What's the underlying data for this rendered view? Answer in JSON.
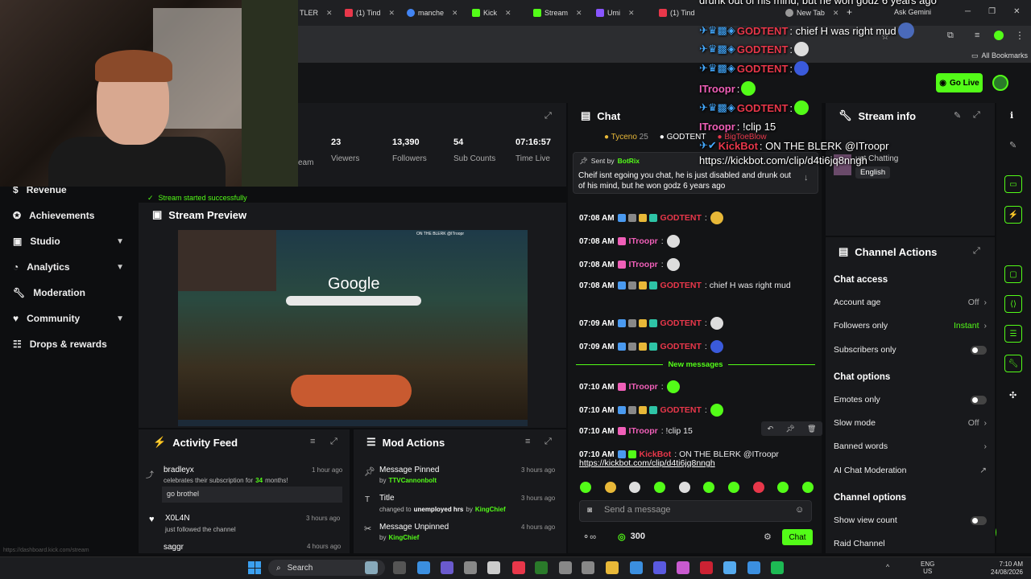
{
  "tabs": [
    {
      "label": "TLER"
    },
    {
      "label": "(1) Tind"
    },
    {
      "label": "manche"
    },
    {
      "label": "Kick"
    },
    {
      "label": "Stream"
    },
    {
      "label": "Umi"
    },
    {
      "label": "(1) Tind"
    },
    {
      "label": "New Tab"
    }
  ],
  "browser": {
    "ask_gemini": "Ask Gemini",
    "all_bookmarks": "All Bookmarks",
    "plus": "+"
  },
  "header": {
    "go_live": "Go Live"
  },
  "sidebar": [
    {
      "label": "Revenue"
    },
    {
      "label": "Achievements"
    },
    {
      "label": "Studio"
    },
    {
      "label": "Analytics"
    },
    {
      "label": "Moderation"
    },
    {
      "label": "Community"
    },
    {
      "label": "Drops & rewards"
    }
  ],
  "stats": [
    {
      "value": "23",
      "label": "Viewers"
    },
    {
      "value": "13,390",
      "label": "Followers"
    },
    {
      "value": "54",
      "label": "Sub Counts"
    },
    {
      "value": "07:16:57",
      "label": "Time Live"
    }
  ],
  "stats_partial": "eam",
  "toast": "Stream started successfully",
  "preview": {
    "title": "Stream Preview",
    "google": "Google",
    "card_text": "ON THE BLERK @ITroopr"
  },
  "activity": {
    "title": "Activity Feed",
    "items": [
      {
        "name": "bradleyx",
        "sub": "celebrates their subscription for",
        "months": "34",
        "months_suffix": "months!",
        "time": "1 hour ago",
        "msg": "go brothel"
      },
      {
        "name": "X0L4N",
        "sub": "just followed the channel",
        "time": "3 hours ago"
      },
      {
        "name": "saggr",
        "time": "4 hours ago"
      }
    ]
  },
  "mod": {
    "title": "Mod Actions",
    "items": [
      {
        "title": "Message Pinned",
        "by": "by",
        "user": "TTVCannonbolt",
        "time": "3 hours ago"
      },
      {
        "title": "Title",
        "detail_pre": "changed to",
        "detail_bold": "unemployed hrs",
        "detail_by": "by",
        "user": "KingChief",
        "time": "3 hours ago"
      },
      {
        "title": "Message Unpinned",
        "by": "by",
        "user": "KingChief",
        "time": "4 hours ago"
      }
    ]
  },
  "chat": {
    "title": "Chat",
    "top_users": [
      {
        "name": "Tyceno",
        "count": "25"
      },
      {
        "name": "GODTENT"
      },
      {
        "name": "BigToeBlow"
      }
    ],
    "pinned": {
      "sent_by": "Sent by",
      "user": "BotRix",
      "text": "Cheif isnt egoing you chat, he is just disabled and drunk out of his mind, but he won godz 6 years ago"
    },
    "messages": [
      {
        "time": "07:08 AM",
        "user": "GODTENT",
        "color": "red",
        "text": ":"
      },
      {
        "time": "07:08 AM",
        "user": "ITroopr",
        "color": "pink",
        "text": ":"
      },
      {
        "time": "07:08 AM",
        "user": "ITroopr",
        "color": "pink",
        "text": ":"
      },
      {
        "time": "07:08 AM",
        "user": "GODTENT",
        "color": "red",
        "text": ": chief H was right mud"
      },
      {
        "time": "07:09 AM",
        "user": "GODTENT",
        "color": "red",
        "text": ":"
      },
      {
        "time": "07:09 AM",
        "user": "GODTENT",
        "color": "red",
        "text": ":"
      },
      {
        "time": "07:10 AM",
        "user": "ITroopr",
        "color": "pink",
        "text": ":"
      },
      {
        "time": "07:10 AM",
        "user": "GODTENT",
        "color": "red",
        "text": ":"
      },
      {
        "time": "07:10 AM",
        "user": "ITroopr",
        "color": "pink",
        "text": ": !clip 15"
      },
      {
        "time": "07:10 AM",
        "user": "KickBot",
        "color": "red",
        "text": ": ON THE BLERK @ITroopr"
      }
    ],
    "new_messages": "New messages",
    "link": "https://kickbot.com/clip/d4ti6jq8nngh",
    "placeholder": "Send a message",
    "points": "300",
    "chat_btn": "Chat"
  },
  "stream_info": {
    "title": "Stream info",
    "partial": "ust Chatting",
    "language": "English"
  },
  "channel_actions": {
    "title": "Channel Actions",
    "chat_access": "Chat access",
    "account_age": "Account age",
    "account_age_v": "Off",
    "followers_only": "Followers only",
    "followers_only_v": "Instant",
    "subs_only": "Subscribers only",
    "chat_options": "Chat options",
    "emotes_only": "Emotes only",
    "slow_mode": "Slow mode",
    "slow_mode_v": "Off",
    "banned_words": "Banned words",
    "ai_mod": "AI Chat Moderation",
    "channel_options": "Channel options",
    "show_view": "Show view count",
    "raid": "Raid Channel"
  },
  "overlay": {
    "line0": "drunk out of his mind, but he won godz 6 years ago",
    "l1_user": "GODTENT",
    "l1_text": ": chief H was right mud",
    "l2_user": "GODTENT",
    "l2_text": ":",
    "l3_user": "GODTENT",
    "l3_text": ":",
    "l4_user": "ITroopr",
    "l4_text": ":",
    "l5_user": "GODTENT",
    "l5_text": ":",
    "l6_user": "ITroopr",
    "l6_text": ": !clip 15",
    "l7_user": "KickBot",
    "l7_text": ": ON THE BLERK @ITroopr",
    "l8_text": "https://kickbot.com/clip/d4ti6jq8nngh"
  },
  "taskbar": {
    "search": "Search",
    "lang1": "ENG",
    "lang2": "US",
    "time": "7:10 AM",
    "date": "24/08/2026"
  },
  "url_hint": "https://dashboard.kick.com/stream",
  "colors": {
    "kick_green": "#53fc18",
    "pink": "#f05fb8",
    "red": "#e8374a"
  }
}
